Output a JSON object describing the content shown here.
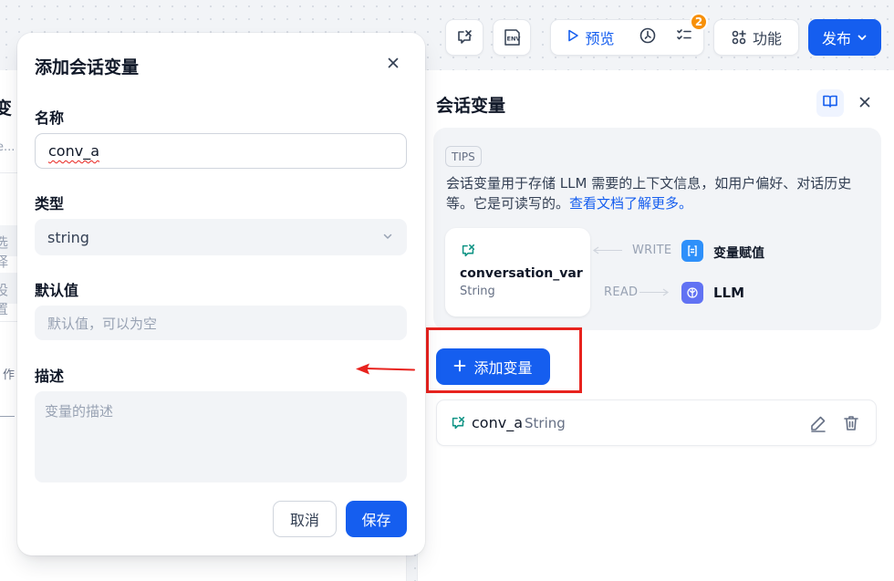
{
  "toolbar": {
    "preview_label": "预览",
    "checklist_badge": "2",
    "features_label": "功能",
    "publish_label": "发布"
  },
  "background_fragments": {
    "frag_title": "变",
    "frag_search": "e...",
    "frag_select": "选择",
    "frag_settings": "设置",
    "frag_work": "作"
  },
  "panel": {
    "title": "会话变量",
    "tips_label": "TIPS",
    "tips_text": "会话变量用于存储 LLM 需要的上下文信息，如用户偏好、对话历史等。它是可读写的。",
    "tips_link": "查看文档了解更多。",
    "example_var_name": "conversation_var",
    "example_var_type": "String",
    "write_label": "WRITE",
    "write_node": "变量赋值",
    "read_label": "READ",
    "read_node": "LLM",
    "add_button": "添加变量",
    "variables": [
      {
        "name": "conv_a",
        "type": "String"
      }
    ]
  },
  "modal": {
    "title": "添加会话变量",
    "name_label": "名称",
    "name_value": "conv_a",
    "type_label": "类型",
    "type_value": "string",
    "default_label": "默认值",
    "default_placeholder": "默认值，可以为空",
    "desc_label": "描述",
    "desc_placeholder": "变量的描述",
    "cancel_label": "取消",
    "save_label": "保存"
  },
  "colors": {
    "accent": "#155eef",
    "badge": "#f79009",
    "highlight": "#e8231e"
  }
}
